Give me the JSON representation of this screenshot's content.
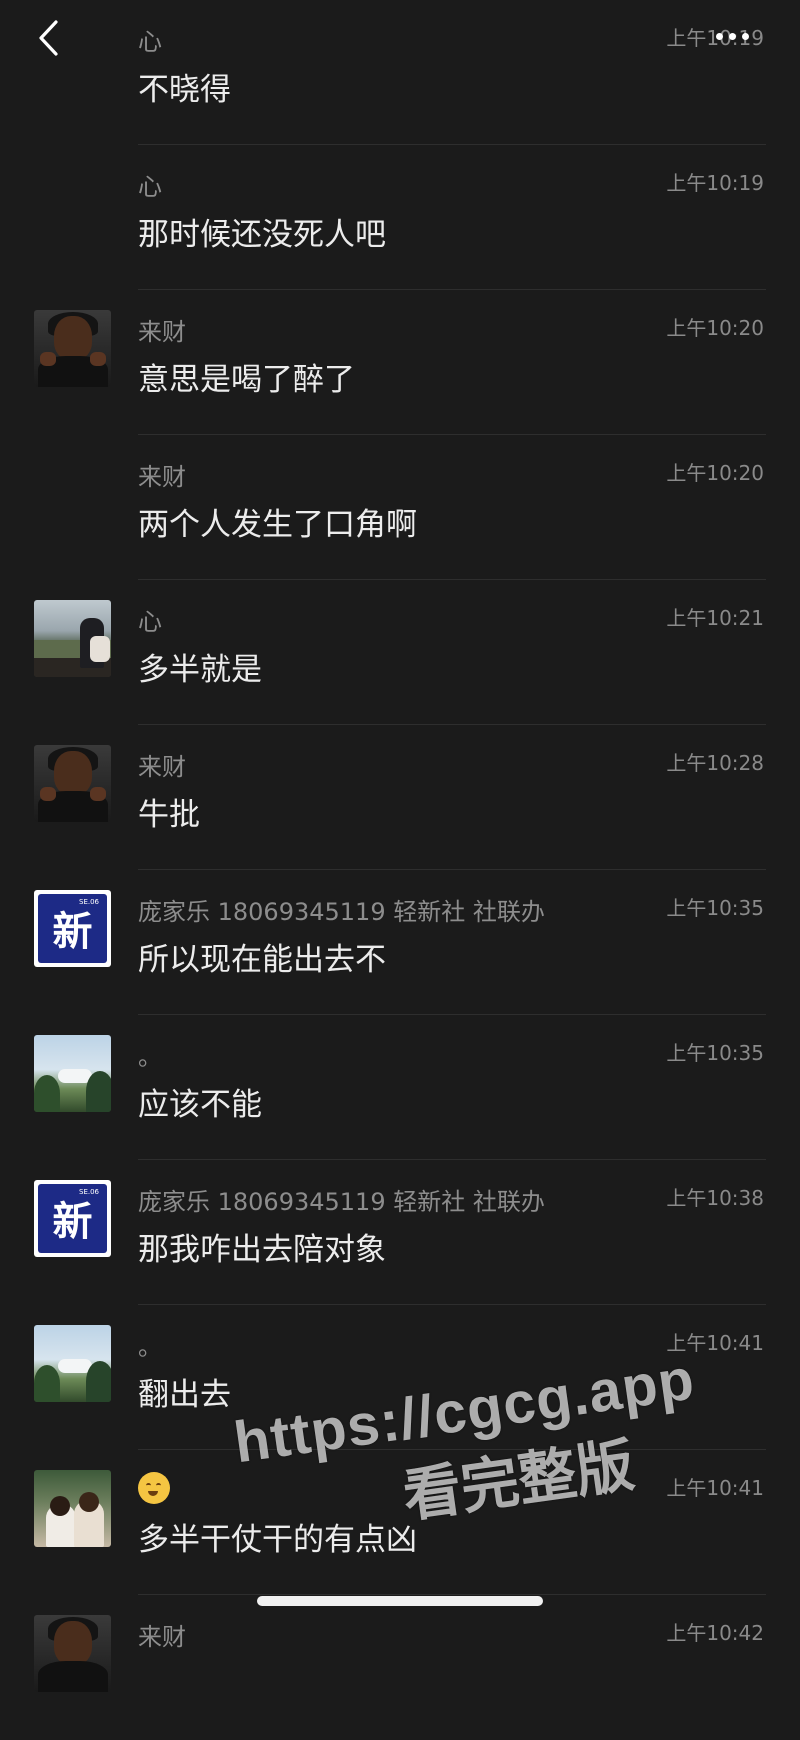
{
  "topbar": {
    "back_icon": "chevron-left-icon",
    "more_icon": "ellipsis-icon"
  },
  "messages": [
    {
      "name": "心",
      "time": "上午10:19",
      "text": "不晓得",
      "avatar": ""
    },
    {
      "name": "心",
      "time": "上午10:19",
      "text": "那时候还没死人吧",
      "avatar": ""
    },
    {
      "name": "来财",
      "time": "上午10:20",
      "text": "意思是喝了醉了",
      "avatar": "man-gold-chain"
    },
    {
      "name": "来财",
      "time": "上午10:20",
      "text": "两个人发生了口角啊",
      "avatar": ""
    },
    {
      "name": "心",
      "time": "上午10:21",
      "text": "多半就是",
      "avatar": "person-backpack-landscape"
    },
    {
      "name": "来财",
      "time": "上午10:28",
      "text": "牛批",
      "avatar": "man-gold-chain"
    },
    {
      "name": "庞家乐 18069345119 轻新社 社联办",
      "time": "上午10:35",
      "text": "所以现在能出去不",
      "avatar": "xin-logo",
      "avatar_char": "新",
      "avatar_small": "SE.06"
    },
    {
      "name": "。",
      "time": "上午10:35",
      "text": "应该不能",
      "avatar": "sky-trees"
    },
    {
      "name": "庞家乐 18069345119 轻新社 社联办",
      "time": "上午10:38",
      "text": "那我咋出去陪对象",
      "avatar": "xin-logo",
      "avatar_char": "新",
      "avatar_small": "SE.06"
    },
    {
      "name": "。",
      "time": "上午10:41",
      "text": "翻出去",
      "avatar": "sky-trees"
    },
    {
      "name": "",
      "name_emoji": "woozy-face-icon",
      "time": "上午10:41",
      "text": "多半干仗干的有点凶",
      "avatar": "couple-photo"
    },
    {
      "name": "来财",
      "time": "上午10:42",
      "text": "",
      "avatar": "man-gold-chain"
    }
  ],
  "watermark": {
    "line1": "https://cgcg.app",
    "line2": "看完整版"
  },
  "colors": {
    "background": "#1b1b1b",
    "text": "#ececec",
    "meta": "#8a8a8a",
    "divider": "#2e2e2e",
    "logo_blue": "#1d2a86"
  }
}
